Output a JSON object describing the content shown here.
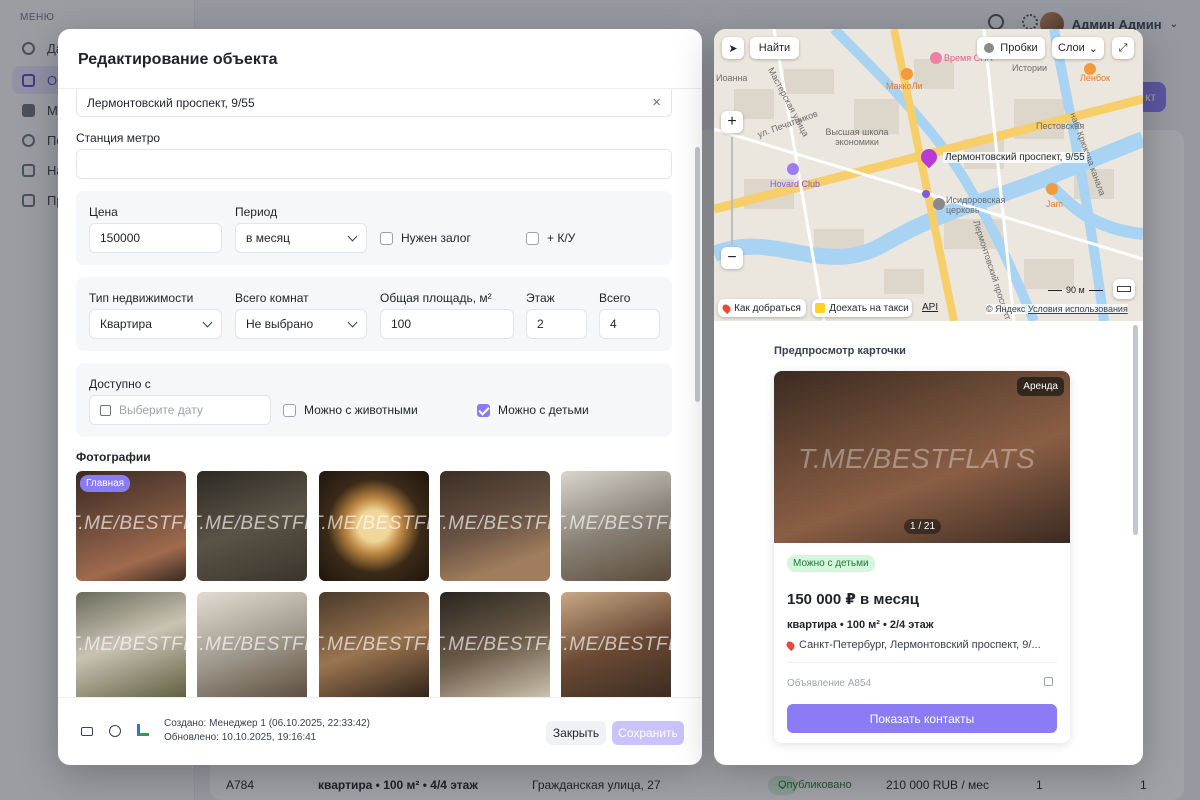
{
  "background": {
    "menu_caption": "МЕНЮ",
    "sidebar_items": [
      "Да",
      "Об",
      "Ме",
      "По",
      "На",
      "Пр"
    ],
    "user_name": "Админ Админ",
    "add_button_fragment": "кт",
    "bottom_row": {
      "id": "A784",
      "spec": "квартира • 100 м² • 4/4 этаж",
      "address": "Гражданская улица, 27",
      "status": "Опубликовано",
      "price": "210 000 RUB / мес",
      "col1": "1",
      "col2": "1"
    }
  },
  "modal": {
    "title": "Редактирование объекта",
    "address_value": "Лермонтовский проспект, 9/55",
    "metro_label": "Станция метро",
    "price_label": "Цена",
    "price_value": "150000",
    "period_label": "Период",
    "period_value": "в месяц",
    "deposit_label": "Нужен залог",
    "utilities_label": "+ К/У",
    "type_label": "Тип недвижимости",
    "type_value": "Квартира",
    "rooms_label": "Всего комнат",
    "rooms_value": "Не выбрано",
    "area_label": "Общая площадь, м²",
    "area_value": "100",
    "floor_label": "Этаж",
    "floor_value": "2",
    "total_label": "Всего",
    "total_value": "4",
    "available_label": "Доступно с",
    "date_placeholder": "Выберите дату",
    "pets_label": "Можно с животными",
    "kids_label": "Можно с детьми",
    "photos_label": "Фотографии",
    "main_badge": "Главная",
    "watermark": "T.ME/BESTFLATS",
    "footer_created": "Создано: Менеджер 1 (06.10.2025, 22:33:42)",
    "footer_updated": "Обновлено: 10.10.2025, 19:16:41",
    "close_label": "Закрыть",
    "save_label": "Сохранить"
  },
  "map": {
    "find_label": "Найти",
    "traffic_label": "Пробки",
    "layers_label": "Слои",
    "marker_label": "Лермонтовский проспект, 9/55",
    "route_label": "Как добраться",
    "taxi_label": "Доехать на такси",
    "api_label": "API",
    "copyright": "© Яндекс",
    "terms": "Условия использования",
    "scale": "90 м",
    "places": [
      "Время СПА",
      "МаккоЛи",
      "Высшая школа экономики",
      "Hovard Club",
      "Исидоровская церковь",
      "Jam",
      "Ленбок",
      "Истории",
      "Иоанна",
      "Пестовская",
      "Мастерская улица",
      "наб. Крюкова канала",
      "ул. Печатников",
      "Лермонтовский проспект"
    ]
  },
  "preview": {
    "caption": "Предпросмотр карточки",
    "badge": "Аренда",
    "counter": "1 / 21",
    "kids_tag": "Можно с детьми",
    "price": "150 000 ₽ в месяц",
    "spec": "квартира • 100 м² • 2/4 этаж",
    "address": "Санкт-Петербург, Лермонтовский проспект, 9/...",
    "ad_id": "Объявление A854",
    "show_contacts": "Показать контакты"
  },
  "colors": {
    "accent": "#8b7cf6",
    "accent_disabled": "#c9c2fb",
    "success_bg": "#d6f5dd",
    "success_text": "#1f7a38"
  }
}
